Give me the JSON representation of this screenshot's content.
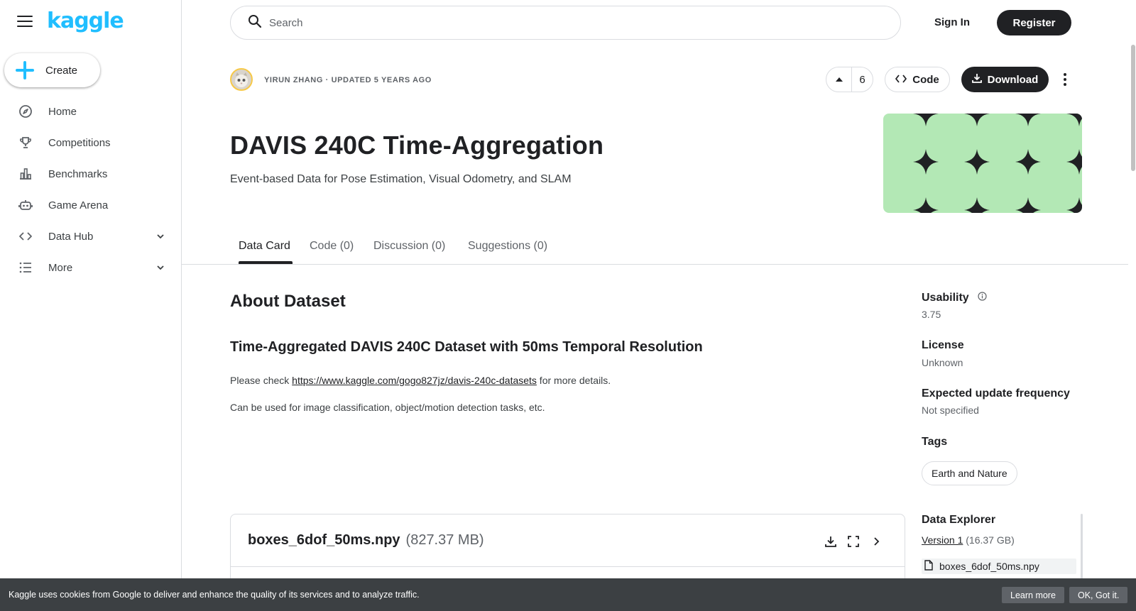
{
  "brand": {
    "logo_text": "kaggle",
    "accent": "#20beff"
  },
  "sidebar": {
    "create_label": "Create",
    "items": [
      {
        "label": "Home",
        "icon": "compass-icon"
      },
      {
        "label": "Competitions",
        "icon": "trophy-icon"
      },
      {
        "label": "Benchmarks",
        "icon": "bar-chart-icon"
      },
      {
        "label": "Game Arena",
        "icon": "robot-icon"
      },
      {
        "label": "Data Hub",
        "icon": "code-icon",
        "expandable": true
      },
      {
        "label": "More",
        "icon": "list-icon",
        "expandable": true
      }
    ]
  },
  "topbar": {
    "search_placeholder": "Search",
    "signin_label": "Sign In",
    "register_label": "Register"
  },
  "dataset": {
    "author_line": "YIRUN ZHANG · UPDATED 5 YEARS AGO",
    "upvotes": "6",
    "code_label": "Code",
    "download_label": "Download",
    "title": "DAVIS 240C Time-Aggregation",
    "subtitle": "Event-based Data for Pose Estimation, Visual Odometry, and SLAM",
    "cover_color": "#b3e8b5"
  },
  "tabs": [
    {
      "label": "Data Card",
      "active": true
    },
    {
      "label": "Code (0)",
      "active": false
    },
    {
      "label": "Discussion (0)",
      "active": false
    },
    {
      "label": "Suggestions (0)",
      "active": false
    }
  ],
  "content": {
    "about_heading": "About Dataset",
    "section_heading": "Time-Aggregated DAVIS 240C Dataset with 50ms Temporal Resolution",
    "para1_prefix": "Please check ",
    "para1_link": "https://www.kaggle.com/gogo827jz/davis-240c-datasets",
    "para1_suffix": " for more details.",
    "para2": "Can be used for image classification, object/motion detection tasks, etc."
  },
  "meta": {
    "usability_label": "Usability",
    "usability_value": "3.75",
    "license_label": "License",
    "license_value": "Unknown",
    "frequency_label": "Expected update frequency",
    "frequency_value": "Not specified",
    "tags_label": "Tags",
    "tags": [
      "Earth and Nature"
    ],
    "explorer_label": "Data Explorer",
    "version_link": "Version 1",
    "version_size": " (16.37 GB)",
    "files": [
      "boxes_6dof_50ms.npy"
    ]
  },
  "file_card": {
    "name": "boxes_6dof_50ms.npy",
    "size": "(827.37 MB)"
  },
  "cookie": {
    "text": "Kaggle uses cookies from Google to deliver and enhance the quality of its services and to analyze traffic.",
    "learn_more": "Learn more",
    "ok": "OK, Got it."
  }
}
